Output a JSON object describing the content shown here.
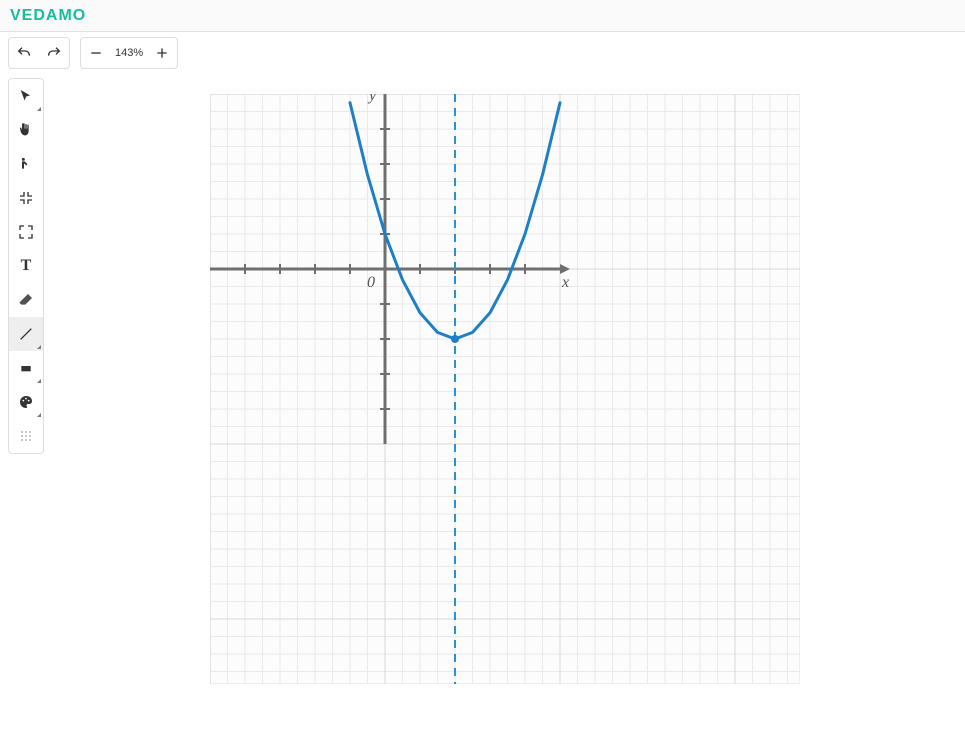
{
  "brand": "VEDAMO",
  "toolbar": {
    "zoom_label": "143%"
  },
  "axes": {
    "x_label": "x",
    "y_label": "y",
    "origin_label": "0"
  },
  "tools": [
    {
      "name": "select",
      "label": "Select"
    },
    {
      "name": "pan",
      "label": "Pan"
    },
    {
      "name": "presenter",
      "label": "Presenter"
    },
    {
      "name": "fit",
      "label": "Fit"
    },
    {
      "name": "fit-all",
      "label": "Fit all"
    },
    {
      "name": "text",
      "label": "Text"
    },
    {
      "name": "eraser",
      "label": "Eraser"
    },
    {
      "name": "line",
      "label": "Line"
    },
    {
      "name": "shape",
      "label": "Shape"
    },
    {
      "name": "color",
      "label": "Color"
    },
    {
      "name": "grid",
      "label": "Grid"
    }
  ],
  "chart_data": {
    "type": "line",
    "title": "",
    "xlabel": "x",
    "ylabel": "y",
    "xlim": [
      -5,
      5
    ],
    "ylim": [
      -5,
      5
    ],
    "vertex": {
      "x": 2,
      "y": -2
    },
    "axis_of_symmetry": 2,
    "series": [
      {
        "name": "parabola",
        "x": [
          -1,
          -0.5,
          0,
          0.5,
          1,
          1.5,
          2,
          2.5,
          3,
          3.5,
          4,
          4.5,
          5
        ],
        "values": [
          4.75,
          2.69,
          1.0,
          -0.31,
          -1.25,
          -1.81,
          -2.0,
          -1.81,
          -1.25,
          -0.31,
          1.0,
          2.69,
          4.75
        ]
      }
    ]
  }
}
